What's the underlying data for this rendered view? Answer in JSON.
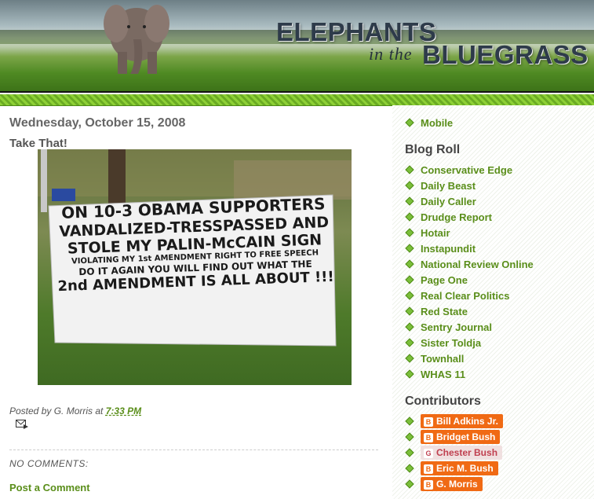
{
  "header": {
    "title_line1": "ELEPHANTS",
    "title_line2": "in the",
    "title_line3": "BLUEGRASS"
  },
  "post": {
    "date": "Wednesday, October 15, 2008",
    "title": "Take That!",
    "sign_text": [
      "ON 10-3 OBAMA SUPPORTERS",
      "VANDALIZED-TRESSPASSED AND",
      "STOLE MY PALIN-McCAIN SIGN",
      "VIOLATING MY 1st AMENDMENT RIGHT TO FREE SPEECH",
      "DO IT AGAIN YOU WILL FIND OUT WHAT THE",
      "2nd AMENDMENT IS ALL ABOUT !!!"
    ],
    "posted_by": "Posted by G. Morris at",
    "time": "7:33 PM",
    "comments_label": "NO COMMENTS:",
    "post_comment": "Post a Comment"
  },
  "sidebar": {
    "top_item": "Mobile",
    "blogroll_heading": "Blog Roll",
    "blogroll": [
      "Conservative Edge",
      "Daily Beast",
      "Daily Caller",
      "Drudge Report",
      "Hotair",
      "Instapundit",
      "National Review Online",
      "Page One",
      "Real Clear Politics",
      "Red State",
      "Sentry Journal",
      "Sister Toldja",
      "Townhall",
      "WHAS 11"
    ],
    "contributors_heading": "Contributors",
    "contributors": [
      "Bill Adkins Jr.",
      "Bridget Bush",
      "Chester Bush",
      "Eric M. Bush",
      "G. Morris"
    ]
  },
  "colors": {
    "link_green": "#5a8e1a",
    "zigzag_green": "#6aab23",
    "contributor_orange": "#f06a14"
  }
}
